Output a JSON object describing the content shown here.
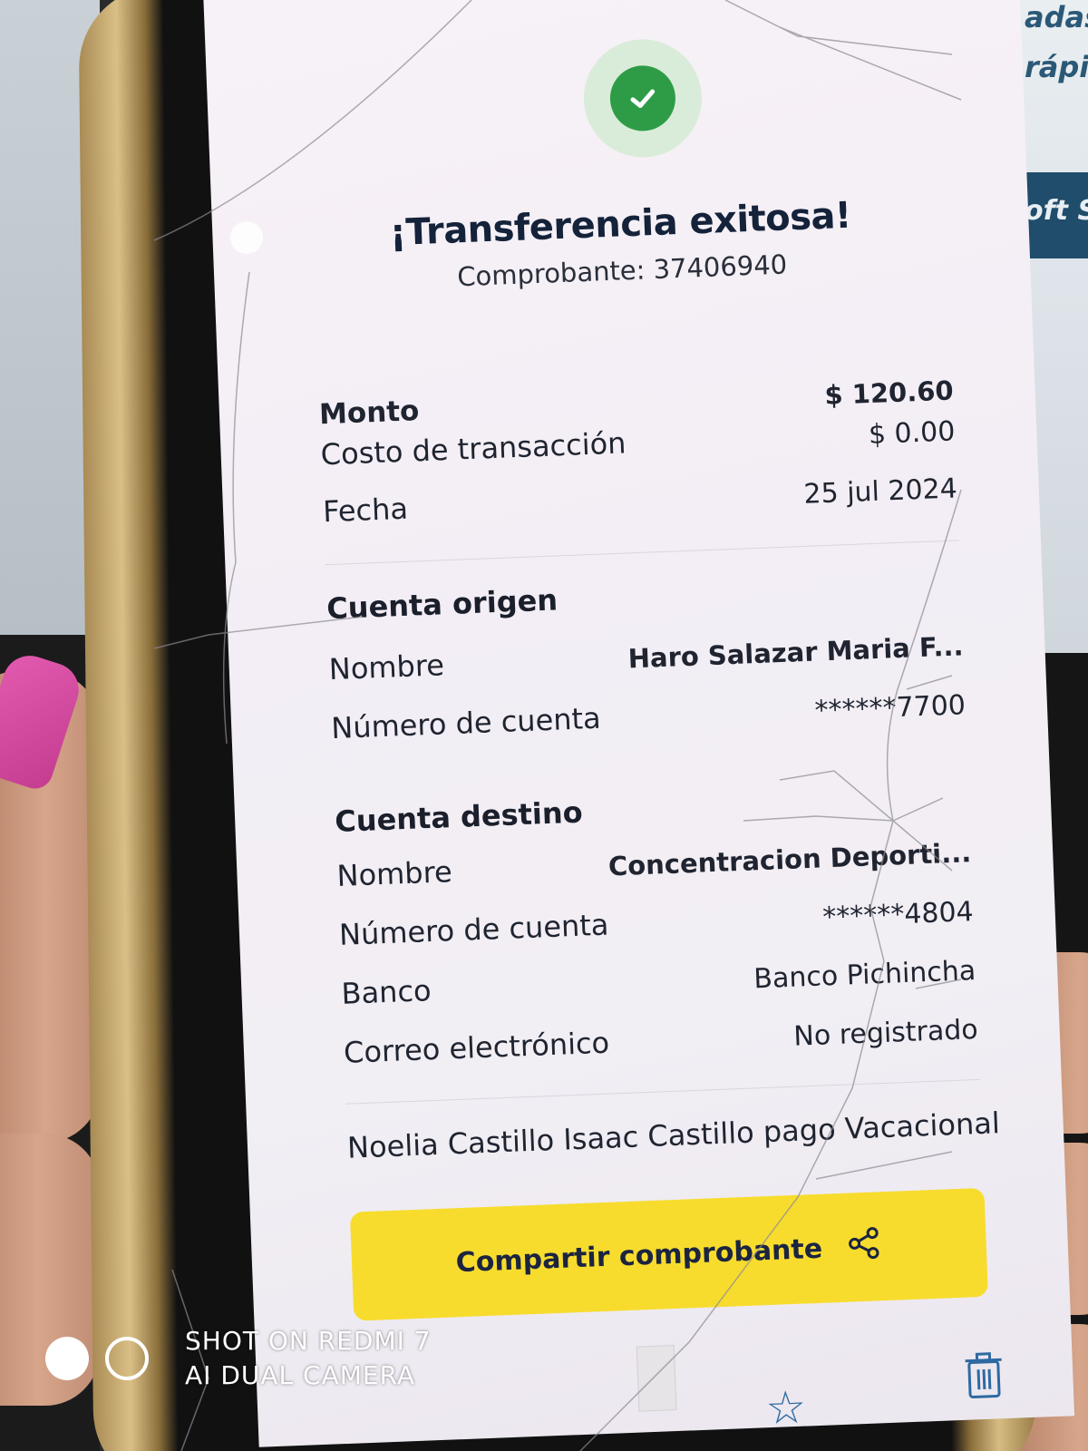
{
  "background": {
    "side_text": [
      "adas",
      "rápi",
      "oft S"
    ]
  },
  "header": {
    "title": "¡Transferencia exitosa!",
    "receipt": "Comprobante: 37406940"
  },
  "summary": {
    "amount_label": "Monto",
    "amount_value": "$ 120.60",
    "fee_label": "Costo de transacción",
    "fee_value": "$ 0.00",
    "date_label": "Fecha",
    "date_value": "25 jul 2024"
  },
  "origin": {
    "heading": "Cuenta origen",
    "name_label": "Nombre",
    "name_value": "Haro  Salazar Maria F...",
    "account_label": "Número de cuenta",
    "account_value": "******7700"
  },
  "destination": {
    "heading": "Cuenta destino",
    "name_label": "Nombre",
    "name_value": "Concentracion Deporti...",
    "account_label": "Número de cuenta",
    "account_value": "******4804",
    "bank_label": "Banco",
    "bank_value": "Banco Pichincha",
    "email_label": "Correo electrónico",
    "email_value": "No registrado"
  },
  "note": "Noelia Castillo  Isaac Castillo pago Vacacional",
  "share_button": {
    "label": "Compartir comprobante",
    "icon": "share-icon"
  },
  "bottom_bar": {
    "icons": [
      "thumbnail",
      "star-icon",
      "trash-icon"
    ]
  },
  "watermark": {
    "line1": "SHOT ON REDMI 7",
    "line2": "AI DUAL CAMERA"
  },
  "colors": {
    "success_green": "#2e9c47",
    "button_yellow": "#f7dc2e",
    "title_navy": "#14223a"
  }
}
